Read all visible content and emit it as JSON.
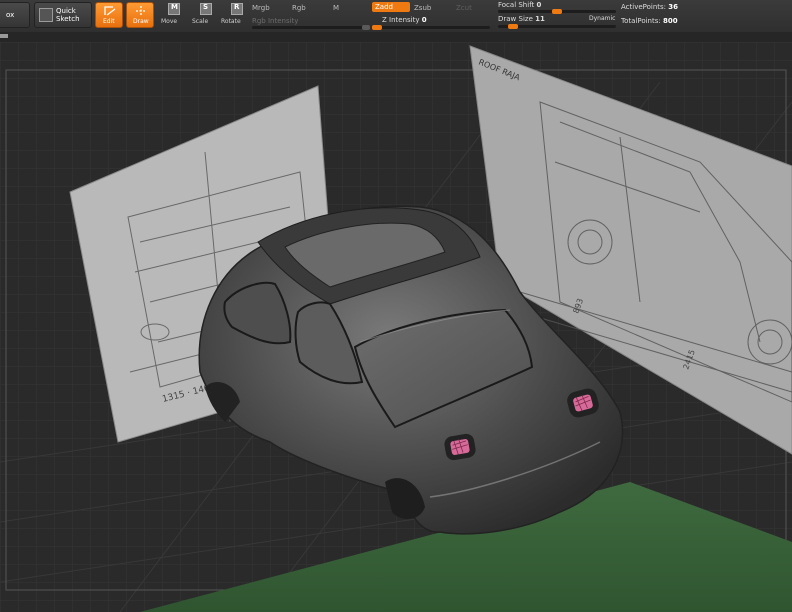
{
  "toolbar": {
    "left_stub_label": "ox",
    "quick_sketch_label": "Quick\nSketch",
    "edit_label": "Edit",
    "draw_label": "Draw",
    "move_label": "Move",
    "scale_label": "Scale",
    "rotate_label": "Rotate",
    "move_key": "M",
    "scale_key": "S",
    "rotate_key": "R",
    "mrgb_label": "Mrgb",
    "rgb_label": "Rgb",
    "m_label": "M",
    "rgb_intensity_label": "Rgb Intensity",
    "zadd_label": "Zadd",
    "zsub_label": "Zsub",
    "zcut_label": "Zcut",
    "z_intensity_label": "Z Intensity",
    "z_intensity_value": "0",
    "focal_shift_label": "Focal Shift",
    "focal_shift_value": "0",
    "draw_size_label": "Draw Size",
    "draw_size_value": "11",
    "dynamic_label": "Dynamic",
    "active_points_label": "ActivePoints:",
    "active_points_value": "36",
    "total_points_label": "TotalPoints:",
    "total_points_value": "800",
    "accent_color": "#f07a12"
  },
  "viewport": {
    "front_blueprint_dims": "1315 · 1400",
    "side_blueprint_label_top": "ROOF RAJA",
    "side_blueprint_dim": "2415",
    "side_blueprint_dim2": "893"
  }
}
